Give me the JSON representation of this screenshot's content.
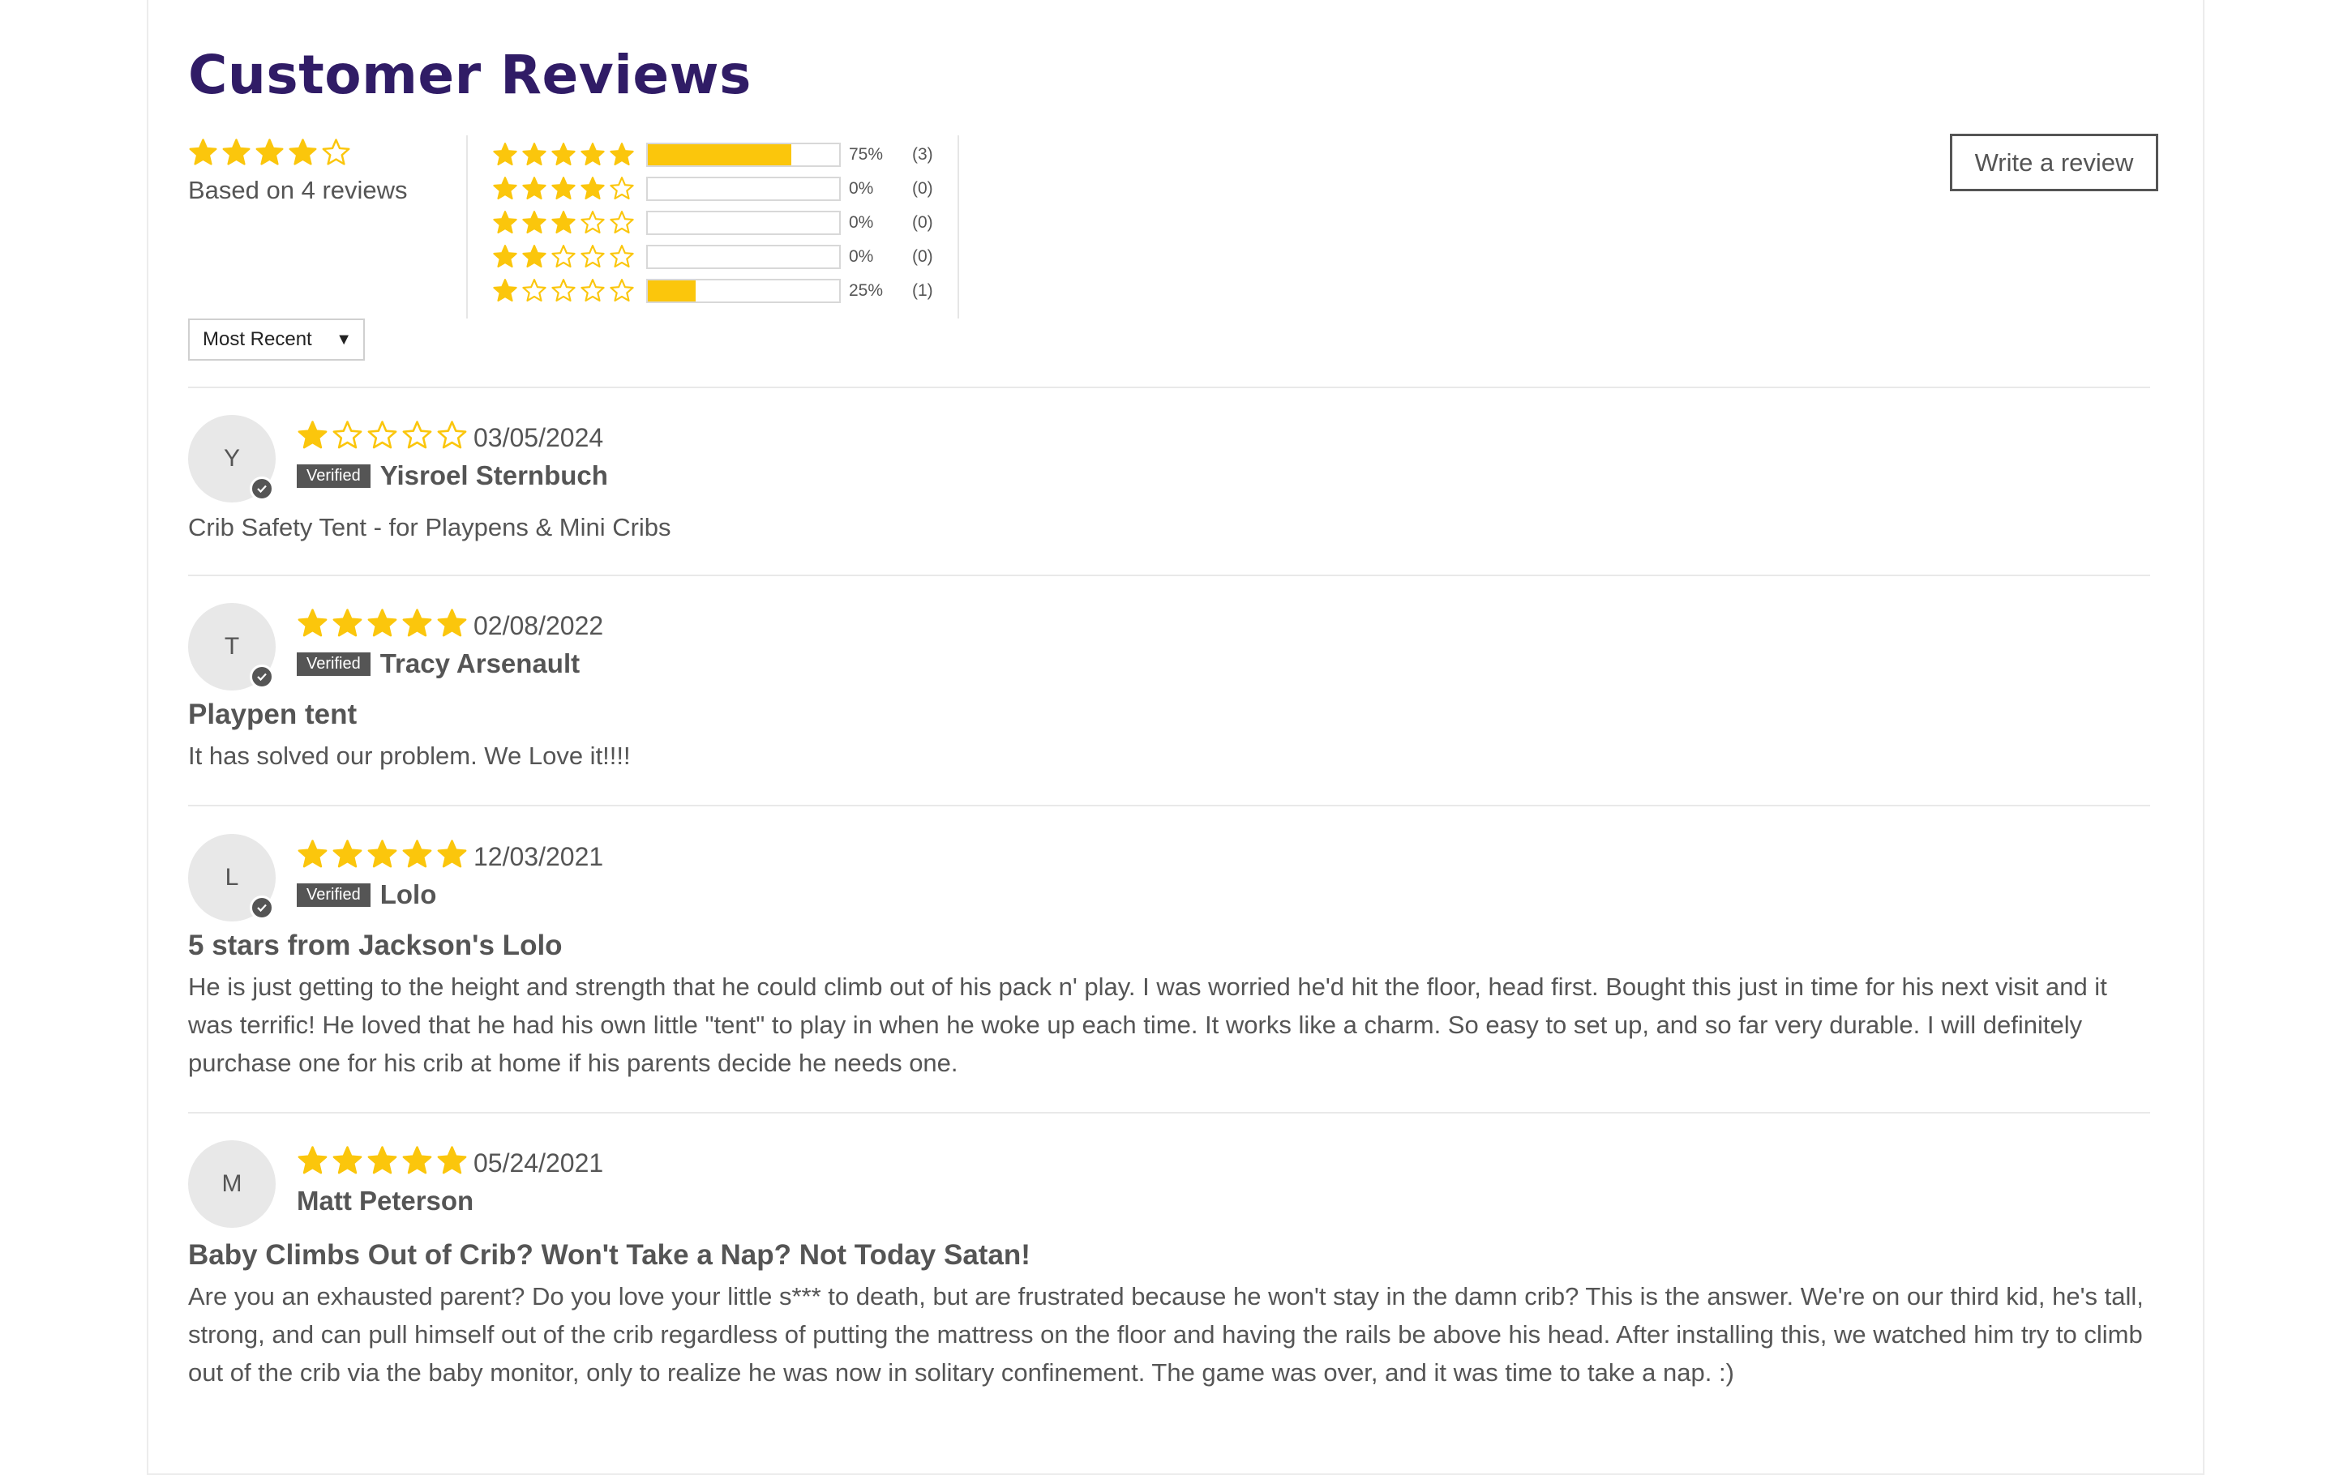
{
  "title": "Customer Reviews",
  "colors": {
    "title": "#301c66",
    "star": "#fbc60c",
    "bar_fill": "#fbc60c",
    "text": "#555555"
  },
  "summary": {
    "average_stars": 4,
    "max_stars": 5,
    "based_on": "Based on 4 reviews"
  },
  "histogram": [
    {
      "stars": 5,
      "fraction": 0.75,
      "percent": "75%",
      "count": "(3)"
    },
    {
      "stars": 4,
      "fraction": 0.0,
      "percent": "0%",
      "count": "(0)"
    },
    {
      "stars": 3,
      "fraction": 0.0,
      "percent": "0%",
      "count": "(0)"
    },
    {
      "stars": 2,
      "fraction": 0.0,
      "percent": "0%",
      "count": "(0)"
    },
    {
      "stars": 1,
      "fraction": 0.25,
      "percent": "25%",
      "count": "(1)"
    }
  ],
  "write_review_label": "Write a review",
  "sort": {
    "selected": "Most Recent",
    "icon": "caret-down-icon"
  },
  "verified_label": "Verified",
  "reviews": [
    {
      "initial": "Y",
      "stars": 1,
      "date": "03/05/2024",
      "verified": true,
      "author": "Yisroel Sternbuch",
      "title": "",
      "body": "Crib Safety Tent - for Playpens & Mini Cribs"
    },
    {
      "initial": "T",
      "stars": 5,
      "date": "02/08/2022",
      "verified": true,
      "author": "Tracy Arsenault",
      "title": "Playpen tent",
      "body": "It has solved our problem. We Love it!!!!"
    },
    {
      "initial": "L",
      "stars": 5,
      "date": "12/03/2021",
      "verified": true,
      "author": "Lolo",
      "title": "5 stars from Jackson's Lolo",
      "body": "He is just getting to the height and strength that he could climb out of his pack n' play. I was worried he'd hit the floor, head first. Bought this just in time for his next visit and it was terrific! He loved that he had his own little \"tent\" to play in when he woke up each time. It works like a charm. So easy to set up, and so far very durable. I will definitely purchase one for his crib at home if his parents decide he needs one."
    },
    {
      "initial": "M",
      "stars": 5,
      "date": "05/24/2021",
      "verified": false,
      "author": "Matt Peterson",
      "title": "Baby Climbs Out of Crib? Won't Take a Nap? Not Today Satan!",
      "body": "Are you an exhausted parent? Do you love your little s*** to death, but are frustrated because he won't stay in the damn crib? This is the answer. We're on our third kid, he's tall, strong, and can pull himself out of the crib regardless of putting the mattress on the floor and having the rails be above his head. After installing this, we watched him try to climb out of the crib via the baby monitor, only to realize he was now in solitary confinement. The game was over, and it was time to take a nap. :)"
    }
  ]
}
